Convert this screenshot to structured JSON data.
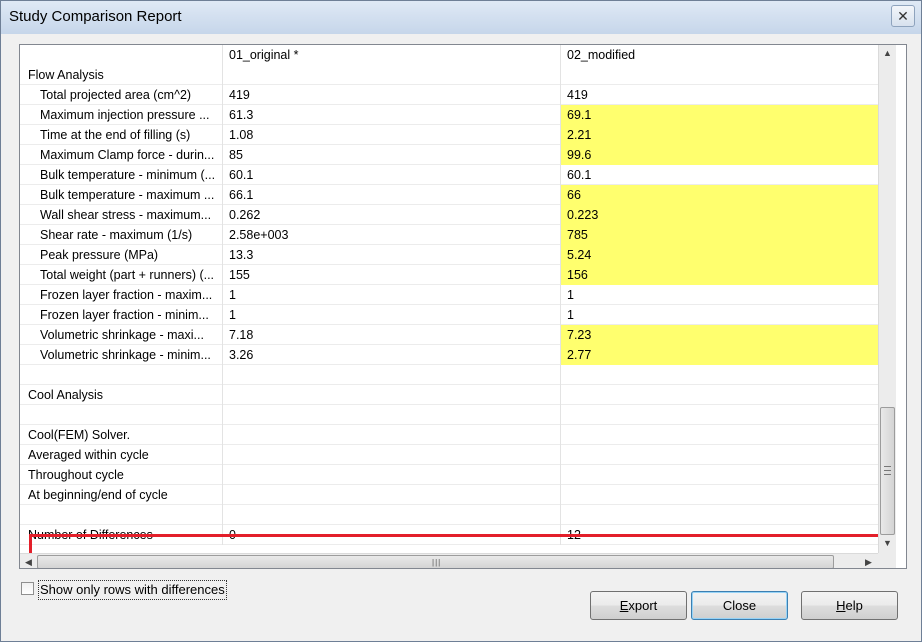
{
  "window": {
    "title": "Study Comparison Report",
    "close_glyph": "✕"
  },
  "grid": {
    "columns": [
      "",
      "01_original *",
      "02_modified"
    ],
    "rows": [
      {
        "label": "Flow Analysis",
        "v1": "",
        "v2": "",
        "child": false,
        "diff": false
      },
      {
        "label": "Total projected area (cm^2)",
        "v1": "419",
        "v2": "419",
        "child": true,
        "diff": false
      },
      {
        "label": "Maximum injection pressure ...",
        "v1": "61.3",
        "v2": "69.1",
        "child": true,
        "diff": true
      },
      {
        "label": "Time at the end of filling (s)",
        "v1": "1.08",
        "v2": "2.21",
        "child": true,
        "diff": true
      },
      {
        "label": "Maximum Clamp force - durin...",
        "v1": "85",
        "v2": "99.6",
        "child": true,
        "diff": true
      },
      {
        "label": "Bulk temperature - minimum (...",
        "v1": "60.1",
        "v2": "60.1",
        "child": true,
        "diff": false
      },
      {
        "label": "Bulk temperature - maximum ...",
        "v1": "66.1",
        "v2": "66",
        "child": true,
        "diff": true
      },
      {
        "label": "Wall shear stress - maximum...",
        "v1": "0.262",
        "v2": "0.223",
        "child": true,
        "diff": true
      },
      {
        "label": "Shear rate - maximum (1/s)",
        "v1": "2.58e+003",
        "v2": "785",
        "child": true,
        "diff": true
      },
      {
        "label": "Peak pressure  (MPa)",
        "v1": "13.3",
        "v2": "5.24",
        "child": true,
        "diff": true
      },
      {
        "label": "Total weight (part + runners) (...",
        "v1": "155",
        "v2": "156",
        "child": true,
        "diff": true
      },
      {
        "label": "Frozen layer fraction - maxim...",
        "v1": "1",
        "v2": "1",
        "child": true,
        "diff": false
      },
      {
        "label": "Frozen layer fraction - minim...",
        "v1": "1",
        "v2": "1",
        "child": true,
        "diff": false
      },
      {
        "label": "Volumetric shrinkage - maxi...",
        "v1": "7.18",
        "v2": "7.23",
        "child": true,
        "diff": true
      },
      {
        "label": "Volumetric shrinkage - minim...",
        "v1": "3.26",
        "v2": "2.77",
        "child": true,
        "diff": true
      },
      {
        "label": "",
        "v1": "",
        "v2": "",
        "child": false,
        "diff": false
      },
      {
        "label": "Cool Analysis",
        "v1": "",
        "v2": "",
        "child": false,
        "diff": false
      },
      {
        "label": "",
        "v1": "",
        "v2": "",
        "child": false,
        "diff": false
      },
      {
        "label": "Cool(FEM) Solver.",
        "v1": "",
        "v2": "",
        "child": false,
        "diff": false
      },
      {
        "label": "Averaged within cycle",
        "v1": "",
        "v2": "",
        "child": false,
        "diff": false
      },
      {
        "label": "Throughout cycle",
        "v1": "",
        "v2": "",
        "child": false,
        "diff": false
      },
      {
        "label": "At beginning/end of cycle",
        "v1": "",
        "v2": "",
        "child": false,
        "diff": false
      },
      {
        "label": "",
        "v1": "",
        "v2": "",
        "child": false,
        "diff": false
      },
      {
        "label": "Number of Differences",
        "v1": "0",
        "v2": "12",
        "child": false,
        "diff": false
      }
    ],
    "highlight_color": "#ffff6e"
  },
  "scrollbars": {
    "up_glyph": "▲",
    "down_glyph": "▼",
    "left_glyph": "◀",
    "right_glyph": "▶",
    "grip_glyph": "|||"
  },
  "options": {
    "show_diff_only_label": "Show only rows with differences",
    "show_diff_only_checked": false
  },
  "buttons": {
    "export": {
      "pre": "",
      "ul": "E",
      "post": "xport"
    },
    "close": {
      "label": "Close"
    },
    "help": {
      "pre": "",
      "ul": "H",
      "post": "elp"
    }
  }
}
